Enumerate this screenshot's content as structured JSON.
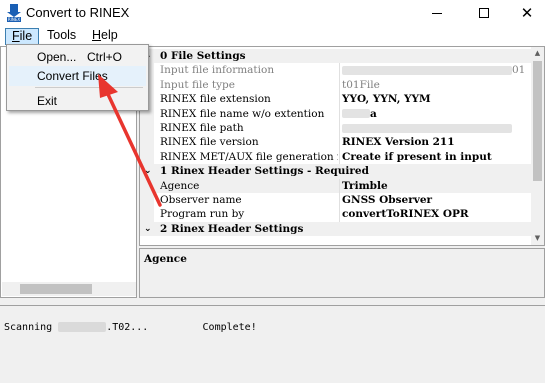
{
  "window": {
    "title": "Convert to RINEX",
    "icon_tag": "RINEX",
    "icon": "rinex-app-icon",
    "controls": {
      "minimize": "minimize-icon",
      "maximize": "maximize-icon",
      "close": "close-icon",
      "close_glyph": "✕"
    }
  },
  "menubar": {
    "file": {
      "label_underline": "F",
      "label_rest": "ile"
    },
    "tools": {
      "label": "Tools"
    },
    "help": {
      "label_underline": "H",
      "label_rest": "elp"
    }
  },
  "file_menu": {
    "open_label": "Open...",
    "open_shortcut": "Ctrl+O",
    "convert_label": "Convert Files",
    "exit_label": "Exit"
  },
  "properties": {
    "categories": [
      {
        "toggle": "⌄",
        "label": "0 File Settings"
      },
      {
        "toggle": "⌄",
        "label": "1 Rinex Header Settings - Required"
      },
      {
        "toggle": "⌄",
        "label": "2 Rinex Header Settings"
      }
    ],
    "rows": [
      {
        "name": "Input file information",
        "value": "",
        "value_tail": "01"
      },
      {
        "name": "Input file type",
        "value": "t01File"
      },
      {
        "name": "RINEX file extension",
        "value": "YYO, YYN, YYM"
      },
      {
        "name": "RINEX file name w/o extention",
        "value": "",
        "value_tail": "a"
      },
      {
        "name": "RINEX file path",
        "value": ""
      },
      {
        "name": "RINEX file version",
        "value": "RINEX Version 211"
      },
      {
        "name": "RINEX MET/AUX file generation rule",
        "value": "Create if present in input"
      },
      {
        "name": "Agence",
        "value": "Trimble"
      },
      {
        "name": "Observer name",
        "value": "GNSS Observer"
      },
      {
        "name": "Program run by",
        "value": "convertToRINEX OPR"
      }
    ],
    "scroll_up": "▲",
    "scroll_down": "▼"
  },
  "description": {
    "title": "Agence"
  },
  "log": {
    "prefix": "Scanning ",
    "suffix": ".T02...",
    "status": "Complete!"
  },
  "colors": {
    "annotation_arrow": "#e8352e",
    "menu_highlight": "#cce8ff",
    "menu_border": "#3c7fb1"
  }
}
